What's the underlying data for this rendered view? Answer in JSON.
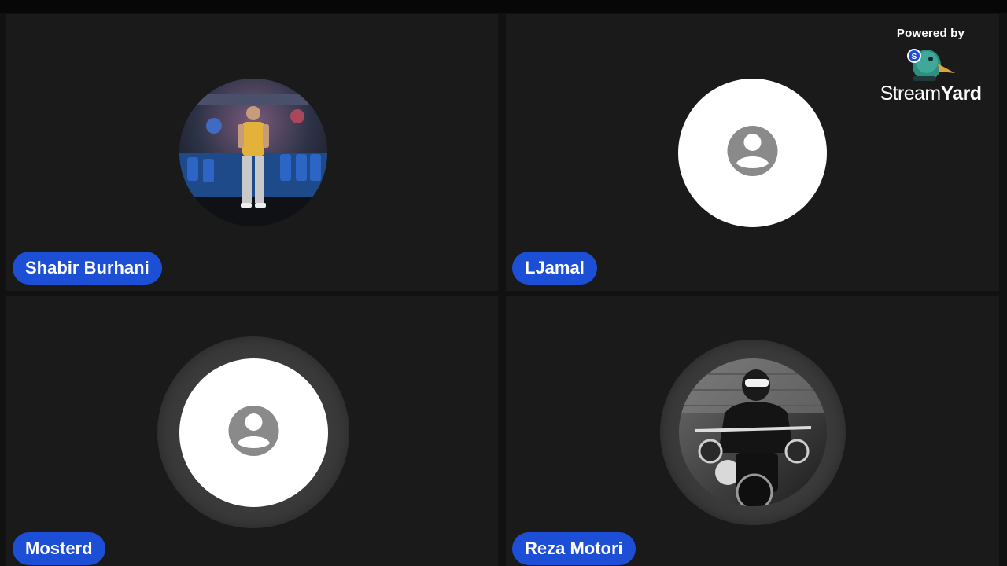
{
  "participants": [
    {
      "name": "Shabir Burhani",
      "avatar": "photo"
    },
    {
      "name": "LJamal",
      "avatar": "default-person-icon"
    },
    {
      "name": "Mosterd",
      "avatar": "default-person-icon"
    },
    {
      "name": "Reza Motori",
      "avatar": "photo"
    }
  ],
  "branding": {
    "powered_by": "Powered by",
    "brand_name_part1": "Stream",
    "brand_name_part2": "Yard",
    "logo_icon": "streamyard-duck-logo-icon"
  },
  "colors": {
    "name_pill": "#1d4fd6",
    "tile_bg": "#1a1a1b",
    "avatar_default_bg": "#ffffff",
    "default_icon": "#8a8a8a"
  }
}
